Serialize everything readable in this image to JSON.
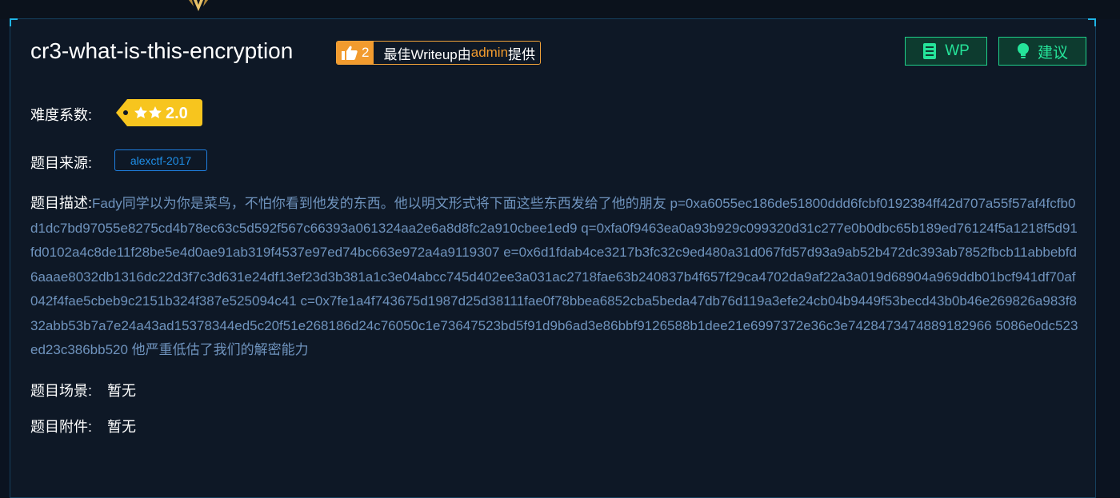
{
  "challenge": {
    "title": "cr3-what-is-this-encryption",
    "writeup_badge": {
      "count": "2",
      "text_before": "最佳Writeup由",
      "author": "admin",
      "text_after": "提供"
    },
    "buttons": {
      "wp_label": "WP",
      "suggest_label": "建议"
    },
    "difficulty": {
      "label": "难度系数:",
      "stars": 2,
      "value": "2.0"
    },
    "source": {
      "label": "题目来源:",
      "tag": "alexctf-2017"
    },
    "description": {
      "label": "题目描述:",
      "text": "Fady同学以为你是菜鸟，不怕你看到他发的东西。他以明文形式将下面这些东西发给了他的朋友 p=0xa6055ec186de51800ddd6fcbf0192384ff42d707a55f57af4fcfb0d1dc7bd97055e8275cd4b78ec63c5d592f567c66393a061324aa2e6a8d8fc2a910cbee1ed9 q=0xfa0f9463ea0a93b929c099320d31c277e0b0dbc65b189ed76124f5a1218f5d91fd0102a4c8de11f28be5e4d0ae91ab319f4537e97ed74bc663e972a4a9119307 e=0x6d1fdab4ce3217b3fc32c9ed480a31d067fd57d93a9ab52b472dc393ab7852fbcb11abbebfd6aaae8032db1316dc22d3f7c3d631e24df13ef23d3b381a1c3e04abcc745d402ee3a031ac2718fae63b240837b4f657f29ca4702da9af22a3a019d68904a969ddb01bcf941df70af042f4fae5cbeb9c2151b324f387e525094c41 c=0x7fe1a4f743675d1987d25d38111fae0f78bbea6852cba5beda47db76d119a3efe24cb04b9449f53becd43b0b46e269826a983f832abb53b7a7e24a43ad15378344ed5c20f51e268186d24c76050c1e73647523bd5f91d9b6ad3e86bbf9126588b1dee21e6997372e36c3e7428473474889182966 5086e0dc523ed23c386bb520 他严重低估了我们的解密能力"
    },
    "scene": {
      "label": "题目场景:",
      "value": "暂无"
    },
    "attachment": {
      "label": "题目附件:",
      "value": "暂无"
    }
  },
  "colors": {
    "accent_green": "#25e49a",
    "accent_orange": "#f29b2e",
    "tag_blue": "#1f8fe8",
    "desc_text": "#6f93bd",
    "star_badge": "#f7c51e"
  }
}
